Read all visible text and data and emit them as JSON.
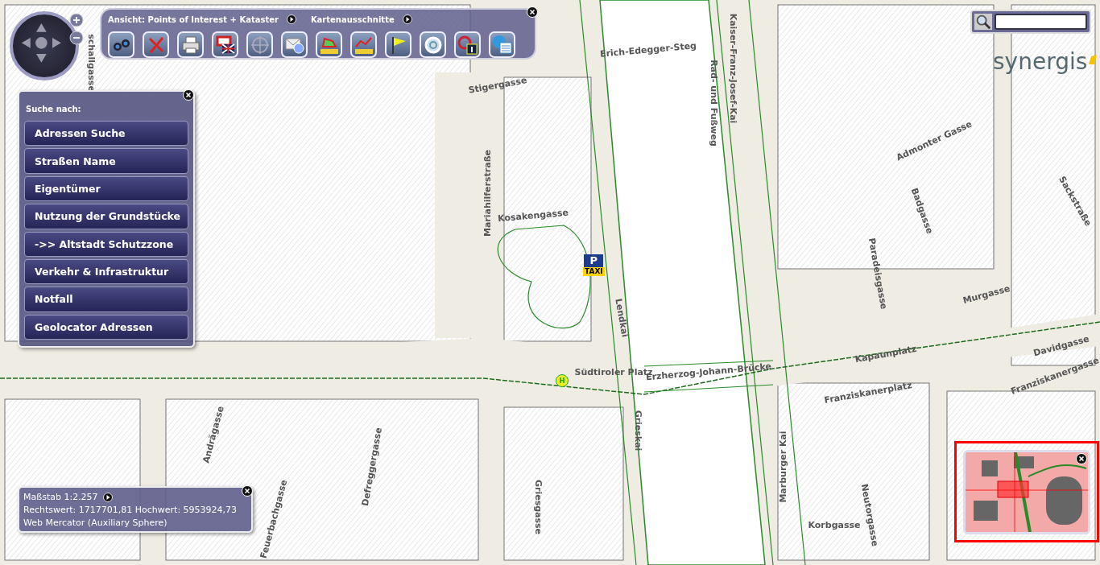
{
  "toolbar": {
    "view_label": "Ansicht: Points of Interest + Kataster",
    "extent_label": "Kartenausschnitte",
    "tools": [
      {
        "kind": "binoculars"
      },
      {
        "kind": "clear"
      },
      {
        "kind": "print"
      },
      {
        "kind": "language"
      },
      {
        "kind": "crosshair"
      },
      {
        "kind": "mail"
      },
      {
        "kind": "area"
      },
      {
        "kind": "line"
      },
      {
        "kind": "flag"
      },
      {
        "kind": "zoom"
      },
      {
        "kind": "info"
      },
      {
        "kind": "legend"
      }
    ]
  },
  "search_panel": {
    "title": "Suche nach:",
    "items": [
      "Adressen Suche",
      "Straßen Name",
      "Eigentümer",
      "Nutzung der Grundstücke",
      "->> Altstadt Schutzzone",
      "Verkehr & Infrastruktur",
      "Notfall",
      "Geolocator Adressen"
    ]
  },
  "logo": "synergis",
  "map_labels": [
    "Mariahilferstraße",
    "Stigergasse",
    "Erich-Edegger-Steg",
    "Kaiser-Franz-Josef-Kai",
    "Rad- und Fußweg",
    "Admonter Gasse",
    "Badgasse",
    "Sackstraße",
    "Kosakengasse",
    "Lendkai",
    "Paradeisgasse",
    "Murgasse",
    "Kapaunplatz",
    "Davidgasse",
    "Franziskanergasse",
    "Franziskanerplatz",
    "Erzherzog-Johann-Brücke",
    "Südtiroler Platz",
    "Grieskai",
    "Marburger Kai",
    "Defreggergasse",
    "Griesgasse",
    "Korbgasse",
    "Neutorgasse",
    "Andrägasse",
    "Feuerbachgasse",
    "schallgasse"
  ],
  "taxi_sign": {
    "parking": "P",
    "label": "TAXI"
  },
  "bus_stop": "H",
  "scale_panel": {
    "scale": "Maßstab 1:2.257",
    "coordinates": "Rechtswert: 1717701,81 Hochwert: 5953924,73",
    "projection": "Web Mercator (Auxiliary Sphere)"
  }
}
